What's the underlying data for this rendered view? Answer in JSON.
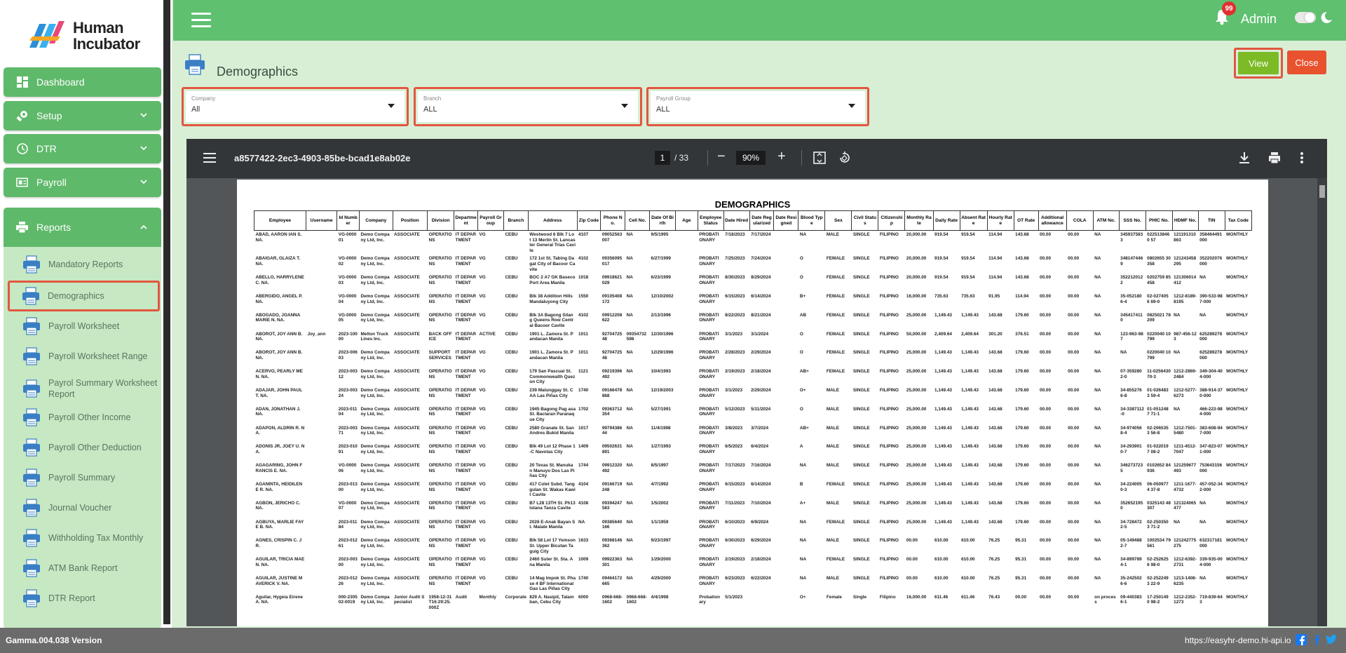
{
  "brand": {
    "line1": "Human",
    "line2": "Incubator"
  },
  "nav": {
    "dashboard": "Dashboard",
    "setup": "Setup",
    "dtr": "DTR",
    "payroll": "Payroll",
    "reports": "Reports"
  },
  "reports_items": [
    "Mandatory Reports",
    "Demographics",
    "Payroll Worksheet",
    "Payroll Worksheet Range",
    "Payrol Summary Worksheet Report",
    "Payroll Other Income",
    "Payroll Other Deduction",
    "Payroll Summary",
    "Journal Voucher",
    "Withholding Tax Monthly",
    "ATM Bank Report",
    "DTR Report"
  ],
  "topbar": {
    "notification_count": "99",
    "user": "Admin"
  },
  "page": {
    "title": "Demographics",
    "view_label": "View",
    "close_label": "Close"
  },
  "filters": {
    "company": {
      "label": "Company",
      "value": "All"
    },
    "branch": {
      "label": "Branch",
      "value": "ALL"
    },
    "payroll_group": {
      "label": "Payroll Group",
      "value": "ALL"
    }
  },
  "viewer": {
    "filename": "a8577422-2ec3-4903-85be-bcad1e8ab02e",
    "page": "1",
    "page_total": "/ 33",
    "zoom": "90%"
  },
  "report": {
    "title": "DEMOGRAPHICS",
    "columns": [
      "Employee",
      "Username",
      "Id Number",
      "Company",
      "Position",
      "Division",
      "Department",
      "Payroll Group",
      "Branch",
      "Address",
      "Zip Code",
      "Phone No.",
      "Cell No.",
      "Date Of Birth",
      "Age",
      "Employee Status",
      "Date Hired",
      "Date Regularized",
      "Date Resigned",
      "Blood Type",
      "Sex",
      "Civil Status",
      "Citizenship",
      "Monthly Rate",
      "Daily Rate",
      "Absent Rate",
      "Hourly Rate",
      "OT Rate",
      "Additional allowance",
      "COLA",
      "ATM No.",
      "SSS No.",
      "PHIC No.",
      "HDMF No.",
      "TIN",
      "Tax Code"
    ],
    "rows": [
      [
        "ABAD, AARON IAN S. NA.",
        "",
        "VG-000001",
        "Demo Company Ltd, Inc.",
        "ASSOCIATE",
        "OPERATIONS",
        "IT DEPARTMENT",
        "VG",
        "CEBU",
        "Westwood 6 Blk 7 Lot 13 Merlin St. Lancaster General Trias Cavite",
        "4107",
        "09052563007",
        "NA",
        "9/5/1995",
        "",
        "PROBATIONARY",
        "7/18/2023",
        "7/17/2024",
        "",
        "NA",
        "MALE",
        "SINGLE",
        "FILIPINO",
        "20,000.00",
        "919.54",
        "919.54",
        "114.94",
        "143.68",
        "00.00",
        "00.00",
        "NA",
        "3459375833",
        "0225138460 57",
        "121191310863",
        "358464491000",
        "MONTHLY"
      ],
      [
        "ABAIGAR, GLAIZA T. NA.",
        "",
        "VG-000002",
        "Demo Company Ltd, Inc.",
        "ASSOCIATE",
        "OPERATIONS",
        "IT DEPARTMENT",
        "VG",
        "CEBU",
        "172 1st St. Tabing Dagat City of Bacoor Cavite",
        "4102",
        "09356095017",
        "NA",
        "6/27/1999",
        "",
        "PROBATIONARY",
        "7/25/2023",
        "7/24/2024",
        "",
        "O",
        "FEMALE",
        "SINGLE",
        "FILIPINO",
        "20,000.00",
        "919.54",
        "919.54",
        "114.94",
        "143.68",
        "00.00",
        "00.00",
        "NA",
        "3481474469",
        "0802655 30358",
        "121243458295",
        "352202076000",
        "MONTHLY"
      ],
      [
        "ABELLO, HARRYLENE C. NA.",
        "",
        "VG-000003",
        "Demo Company Ltd, Inc.",
        "ASSOCIATE",
        "OPERATIONS",
        "IT DEPARTMENT",
        "VG",
        "CEBU",
        "BOC 2 A7 GK Baseco Port Area Manila",
        "1018",
        "09918621029",
        "NA",
        "6/23/1999",
        "",
        "PROBATIONARY",
        "8/30/2023",
        "8/29/2024",
        "",
        "O",
        "FEMALE",
        "SINGLE",
        "FILIPINO",
        "20,000.00",
        "919.54",
        "919.54",
        "114.94",
        "143.68",
        "00.00",
        "00.00",
        "NA",
        "3522120122",
        "0202759 85458",
        "121306014412",
        "NA",
        "MONTHLY"
      ],
      [
        "ABERGIDO, ANGEL P. NA.",
        "",
        "VG-000004",
        "Demo Company Ltd, Inc.",
        "ASSOCIATE",
        "OPERATIONS",
        "IT DEPARTMENT",
        "VG",
        "CEBU",
        "Blk 38 Addition Hills Mandaluyong City",
        "1550",
        "09105408172",
        "NA",
        "12/10/2002",
        "",
        "PROBATIONARY",
        "6/15/2023",
        "6/14/2024",
        "",
        "B+",
        "FEMALE",
        "SINGLE",
        "FILIPINO",
        "16,000.00",
        "735.63",
        "735.63",
        "91.95",
        "114.94",
        "00.00",
        "00.00",
        "NA",
        "35-0521806-4",
        "02-0274056 69-0",
        "1212-8189-8195",
        "390-533-987-000",
        "MONTHLY"
      ],
      [
        "ABOGADO, JOANNA MARIE N. NA.",
        "",
        "VG-000005",
        "Demo Company Ltd, Inc.",
        "ASSOCIATE",
        "OPERATIONS",
        "IT DEPARTMENT",
        "VG",
        "CEBU",
        "Blk 3A Bagong Silang Queens Row Central Bacoor Cavite",
        "4102",
        "09912208622",
        "NA",
        "2/13/1996",
        "",
        "PROBATIONARY",
        "8/22/2023",
        "8/21/2024",
        "",
        "AB",
        "FEMALE",
        "SINGLE",
        "FILIPINO",
        "25,000.00",
        "1,149.43",
        "1,149.43",
        "143.68",
        "179.60",
        "00.00",
        "00.00",
        "NA",
        "3454174110",
        "0825021 78209",
        "NA",
        "NA",
        "MONTHLY"
      ],
      [
        "ABOROT, JOY ANN B. NA.",
        "Joy_ann",
        "2023-10000",
        "Melton Truck Lines Inc.",
        "ASSOCIATE",
        "BACK OFFICE",
        "IT DEPARTMENT",
        "ACTIVE",
        "CEBU",
        "1901 L. Zamora St. Pandacan Manila",
        "1011",
        "9270472548",
        "09354732598",
        "12/30/1996",
        "",
        "PROBATIONARY",
        "3/1/2023",
        "3/1/2024",
        "",
        "O",
        "FEMALE",
        "SINGLE",
        "FILIPINO",
        "50,000.00",
        "2,409.64",
        "2,409.64",
        "301.20",
        "376.51",
        "00.00",
        "00.00",
        "NA",
        "123-963-987",
        "0220040 10799",
        "987-456-123",
        "625289278000",
        "MONTHLY"
      ],
      [
        "ABOROT, JOY ANN B. NA.",
        "",
        "2023-00603",
        "Demo Company Ltd, Inc.",
        "ASSOCIATE",
        "SUPPORT SERVICES",
        "IT DEPARTMENT",
        "VG",
        "CEBU",
        "1901 L. Zamora St. Pandacan Manila",
        "1011",
        "9270472548",
        "NA",
        "12/29/1996",
        "",
        "PROBATIONARY",
        "2/28/2023",
        "2/29/2024",
        "",
        "O",
        "FEMALE",
        "SINGLE",
        "FILIPINO",
        "25,000.00",
        "1,149.43",
        "1,149.43",
        "143.68",
        "179.60",
        "00.00",
        "00.00",
        "NA",
        "NA",
        "0220040 10799",
        "NA",
        "625289278000",
        "MONTHLY"
      ],
      [
        "ACERVO, PEARLY ME N. NA.",
        "",
        "2023-00312",
        "Demo Company Ltd, Inc.",
        "ASSOCIATE",
        "OPERATIONS",
        "IT DEPARTMENT",
        "VG",
        "CEBU",
        "179 San Pascual St. Commonwealth Quezon City",
        "1121",
        "09219396492",
        "NA",
        "10/4/1993",
        "",
        "PROBATIONARY",
        "2/19/2023",
        "2/18/2024",
        "",
        "AB+",
        "FEMALE",
        "SINGLE",
        "FILIPINO",
        "25,000.00",
        "1,149.43",
        "1,149.43",
        "143.68",
        "179.60",
        "00.00",
        "00.00",
        "NA",
        "07-3592802-0",
        "11-0256430 70-3",
        "1212-2869-2484",
        "349-304-404-000",
        "MONTHLY"
      ],
      [
        "ADAJAR, JOHN PAUL T. NA.",
        "",
        "2023-00324",
        "Demo Company Ltd, Inc.",
        "ASSOCIATE",
        "OPERATIONS",
        "IT DEPARTMENT",
        "VG",
        "CEBU",
        "239 Malunggay St. CAA Las Piñas City",
        "1740",
        "09166478868",
        "NA",
        "12/19/2003",
        "",
        "PROBATIONARY",
        "3/1/2023",
        "2/29/2024",
        "",
        "O+",
        "MALE",
        "SINGLE",
        "FILIPINO",
        "25,000.00",
        "1,149.43",
        "1,149.43",
        "143.68",
        "179.60",
        "00.00",
        "00.00",
        "NA",
        "34-8552766-8",
        "01-0264833 59-4",
        "1212-5277-6273",
        "388-914-370-000",
        "MONTHLY"
      ],
      [
        "ADAN, JONATHAN J. NA.",
        "",
        "2023-01104",
        "Demo Company Ltd, Inc.",
        "ASSOCIATE",
        "OPERATIONS",
        "IT DEPARTMENT",
        "VG",
        "CEBU",
        "1945 Bagong Pag asa St. Baclaran Paranaque City",
        "1702",
        "09363712354",
        "NA",
        "5/27/1991",
        "",
        "PROBATIONARY",
        "5/12/2023",
        "5/11/2024",
        "",
        "O",
        "MALE",
        "SINGLE",
        "FILIPINO",
        "25,000.00",
        "1,149.43",
        "1,149.43",
        "143.68",
        "179.60",
        "00.00",
        "00.00",
        "NA",
        "34-3387112-0",
        "01-0512487 71-1",
        "NA",
        "466-223-984-000",
        "MONTHLY"
      ],
      [
        "ADAPON, ALDRIN R. NA.",
        "",
        "2023-00371",
        "Demo Company Ltd, Inc.",
        "ASSOCIATE",
        "OPERATIONS",
        "IT DEPARTMENT",
        "VG",
        "CEBU",
        "2580 Granate St. San Andres Bukid Manila",
        "1017",
        "9979438644",
        "NA",
        "11/4/1998",
        "",
        "PROBATIONARY",
        "3/8/2023",
        "3/7/2024",
        "",
        "AB+",
        "MALE",
        "SINGLE",
        "FILIPINO",
        "25,000.00",
        "1,149.43",
        "1,149.43",
        "143.68",
        "179.60",
        "00.00",
        "00.00",
        "NA",
        "34-9740568-4",
        "02-2065353 56-8",
        "1212-7501-5480",
        "383-608-947-000",
        "MONTHLY"
      ],
      [
        "ADONIS JR, JOEY U. NA.",
        "",
        "2023-01091",
        "Demo Company Ltd, Inc.",
        "ASSOCIATE",
        "OPERATIONS",
        "IT DEPARTMENT",
        "VG",
        "CEBU",
        "Blk 49 Lot 12 Phase 1-C Navotas City",
        "1409",
        "09502631891",
        "NA",
        "1/27/1993",
        "",
        "PROBATIONARY",
        "6/5/2023",
        "6/4/2024",
        "",
        "A",
        "MALE",
        "SINGLE",
        "FILIPINO",
        "25,000.00",
        "1,149.43",
        "1,149.43",
        "143.68",
        "179.60",
        "00.00",
        "00.00",
        "NA",
        "34-2939010-7",
        "01-0220197 08-2",
        "1211-4512-7047",
        "347-823-071-000",
        "MONTHLY"
      ],
      [
        "AGAGARING, JOHN FRANCIS E. NA.",
        "",
        "VG-000006",
        "Demo Company Ltd, Inc.",
        "ASSOCIATE",
        "OPERATIONS",
        "IT DEPARTMENT",
        "VG",
        "CEBU",
        "20 Texas St. Manukan Manuyo Dos Las Piñas City",
        "1744",
        "09912320492",
        "NA",
        "8/5/1997",
        "",
        "PROBATIONARY",
        "7/17/2023",
        "7/16/2024",
        "",
        "NA",
        "MALE",
        "SINGLE",
        "FILIPINO",
        "25,000.00",
        "1,149.43",
        "1,149.43",
        "143.68",
        "179.60",
        "00.00",
        "00.00",
        "NA",
        "3462737235",
        "0102652 84936",
        "121259677493",
        "753643156000",
        "MONTHLY"
      ],
      [
        "AGANINTA, HEIDILENE R. NA.",
        "",
        "2023-01300",
        "Demo Company Ltd, Inc.",
        "ASSOCIATE",
        "OPERATIONS",
        "IT DEPARTMENT",
        "VG",
        "CEBU",
        "417 Colet Subd. Tanggulan St. Wakas Kawit Cavite",
        "4104",
        "09166719248",
        "NA",
        "4/7/1992",
        "",
        "PROBATIONARY",
        "6/15/2023",
        "6/14/2024",
        "",
        "B",
        "FEMALE",
        "SINGLE",
        "FILIPINO",
        "25,000.00",
        "1,149.43",
        "1,149.43",
        "143.68",
        "179.60",
        "00.00",
        "00.00",
        "NA",
        "34-2240050-3",
        "06-0509774 37-8",
        "1211-1677-4732",
        "457-052-342-000",
        "MONTHLY"
      ],
      [
        "AGBON, JERICHO C. NA.",
        "",
        "VG-000007",
        "Demo Company Ltd, Inc.",
        "ASSOCIATE",
        "OPERATIONS",
        "IT DEPARTMENT",
        "VG",
        "CEBU",
        "B7 L28 13TH St. Ph13 Istana Tanza Cavite",
        "4108",
        "09394247583",
        "NA",
        "1/5/2002",
        "",
        "PROBATIONARY",
        "7/11/2023",
        "7/10/2024",
        "",
        "A+",
        "MALE",
        "SINGLE",
        "FILIPINO",
        "25,000.00",
        "1,149.43",
        "1,149.43",
        "143.68",
        "179.60",
        "00.00",
        "00.00",
        "NA",
        "3526521950",
        "0325143 48307",
        "121324065477",
        "NA",
        "MONTHLY"
      ],
      [
        "AGBUYA, MARLIE FAYE B. NA.",
        "",
        "2023-01184",
        "Demo Company Ltd, Inc.",
        "ASSOCIATE",
        "OPERATIONS",
        "IT DEPARTMENT",
        "VG",
        "CEBU",
        "2026 E-Anak Bayan St. Malate Manila",
        "NA",
        "09385640166",
        "NA",
        "1/1/1959",
        "",
        "PROBATIONARY",
        "6/10/2023",
        "6/9/2024",
        "",
        "NA",
        "FEMALE",
        "SINGLE",
        "FILIPINO",
        "25,000.00",
        "1,149.43",
        "1,149.43",
        "143.68",
        "179.60",
        "00.00",
        "00.00",
        "NA",
        "34-7284722-5",
        "02-2503503 71-2",
        "NA",
        "NA",
        "MONTHLY"
      ],
      [
        "AGNES, CRISPIN C. JR.",
        "",
        "2023-01261",
        "Demo Company Ltd, Inc.",
        "ASSOCIATE",
        "OPERATIONS",
        "IT DEPARTMENT",
        "VG",
        "CEBU",
        "Blk 58 Lot 17 Yemson St. Upper Bicutan Taguig City",
        "1633",
        "09368146362",
        "NA",
        "9/23/1997",
        "",
        "PROBATIONARY",
        "6/30/2023",
        "6/29/2024",
        "",
        "NA",
        "MALE",
        "SINGLE",
        "FILIPINO",
        "00.00",
        "610.00",
        "610.00",
        "76.25",
        "95.31",
        "00.00",
        "00.00",
        "NA",
        "05-1494882-7",
        "1002534 79561",
        "121242775275",
        "632317181000",
        "MONTHLY"
      ],
      [
        "AGUILAR, TRICIA MAE N. NA.",
        "",
        "2023-00300",
        "Demo Company Ltd, Inc.",
        "ASSOCIATE",
        "OPERATIONS",
        "IT DEPARTMENT",
        "VG",
        "CEBU",
        "2460 Suter St. Sta. Ana Manila",
        "1009",
        "09922363301",
        "NA",
        "1/29/2000",
        "",
        "PROBATIONARY",
        "2/19/2023",
        "2/18/2024",
        "",
        "NA",
        "FEMALE",
        "SINGLE",
        "FILIPINO",
        "00.00",
        "610.00",
        "610.00",
        "76.25",
        "95.31",
        "00.00",
        "00.00",
        "NA",
        "34-8997894-1",
        "02-2526256 98-0",
        "1212-6392-2731",
        "339-935-004-000",
        "MONTHLY"
      ],
      [
        "AGUILAR, JUSTINE MAVERICK V. NA.",
        "",
        "2023-01226",
        "Demo Company Ltd, Inc.",
        "ASSOCIATE",
        "OPERATIONS",
        "IT DEPARTMENT",
        "VG",
        "CEBU",
        "14 Mag Impok St. Phase 4 BF International Gas Las Piñas City",
        "1740",
        "09464172665",
        "NA",
        "4/29/2000",
        "",
        "PROBATIONARY",
        "6/23/2023",
        "6/22/2024",
        "",
        "NA",
        "MALE",
        "SINGLE",
        "FILIPINO",
        "00.00",
        "610.00",
        "610.00",
        "76.25",
        "95.31",
        "00.00",
        "00.00",
        "NA",
        "35-2425026-6",
        "02-2522493 22-9",
        "1213-1408-6235",
        "NA",
        "MONTHLY"
      ],
      [
        "Aguilar, Hygeia Eirene A. NA.",
        "",
        "000-230502-0019",
        "Demo Company Ltd, Inc.",
        "Junior Audit Specialist",
        "1958-12-31T16:29:25.000Z",
        "Audit",
        "Monthly",
        "Corporate",
        "829 A. Nasipit, Talamban, Cebu City",
        "6000",
        "0968-668-1602",
        "0968-668-1602",
        "4/4/1998",
        "",
        "Probationary",
        "5/1/2023",
        "",
        "",
        "O+",
        "Female",
        "Single",
        "Filipino",
        "16,000.00",
        "611.46",
        "611.46",
        "76.43",
        "00.00",
        "00.00",
        "00.00",
        "on process",
        "09-4403836-1",
        "17-2501490 98-2",
        "1212-2352-1273",
        "719-839-643",
        "MONTHLY"
      ]
    ]
  },
  "footer": {
    "version": "Gamma.004.038 Version",
    "url": "https://easyhr-demo.hi-api.io"
  },
  "colors": {
    "primary_green": "#5fc070",
    "nav_green": "#5fb96b",
    "highlight_red": "#e25640",
    "view_green": "#7cba26",
    "close_orange": "#e8522f"
  }
}
